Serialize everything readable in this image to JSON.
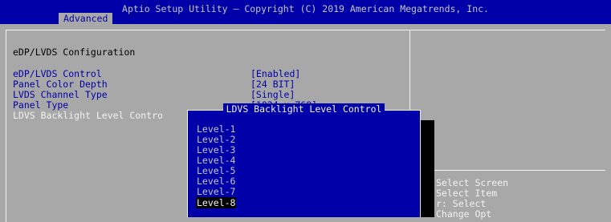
{
  "header": {
    "title": "Aptio Setup Utility – Copyright (C) 2019 American Megatrends, Inc.",
    "active_tab": "Advanced"
  },
  "main": {
    "heading": "eDP/LVDS Configuration",
    "settings": [
      {
        "label": "eDP/LVDS Control",
        "value": "[Enabled]"
      },
      {
        "label": "Panel Color Depth",
        "value": "[24 BIT]"
      },
      {
        "label": "LVDS Channel Type",
        "value": "[Single]"
      },
      {
        "label": "Panel Type",
        "value": "[1024 x 768]"
      },
      {
        "label": "LDVS Backlight Level Contro",
        "value": ""
      }
    ]
  },
  "popup": {
    "title": "LDVS Backlight Level Control",
    "options": [
      "Level-1",
      "Level-2",
      "Level-3",
      "Level-4",
      "Level-5",
      "Level-6",
      "Level-7",
      "Level-8"
    ],
    "selected": "Level-8"
  },
  "help": {
    "lines": [
      "Select Screen",
      "Select Item",
      "r: Select",
      "Change Opt"
    ]
  },
  "colors": {
    "background": "#a8a8a8",
    "header": "#0000a8",
    "value_text": "#0000a8",
    "highlight_text": "#f2f2f2"
  }
}
